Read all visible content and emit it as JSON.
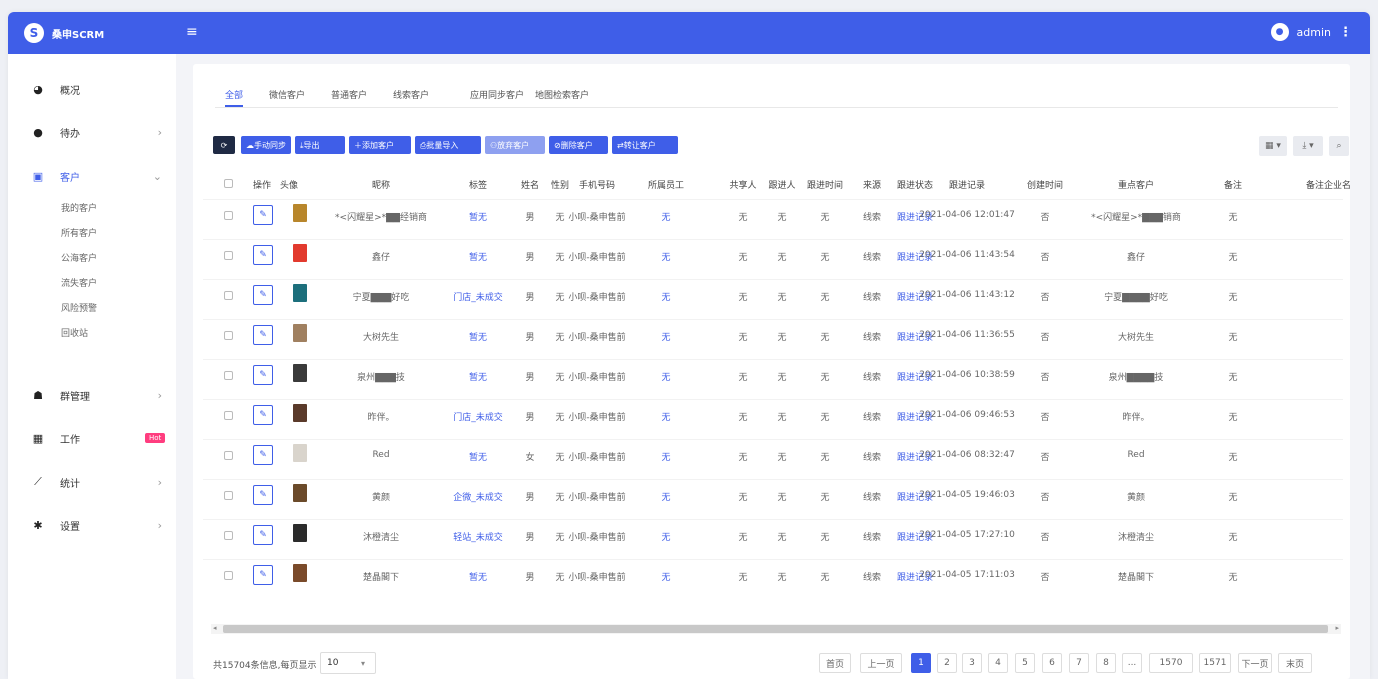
{
  "brand": {
    "logo_letter": "S",
    "name": "桑申SCRM"
  },
  "topbar": {
    "menu_icon": "≡",
    "avatar_letter": "●",
    "user": "admin",
    "more_icon": "⋮"
  },
  "sidebar": {
    "items": [
      {
        "label": "概况",
        "icon": "dashboard-icon",
        "glyph": "◕",
        "arrow": ""
      },
      {
        "label": "待办",
        "icon": "todo-icon",
        "glyph": "●",
        "arrow": "›"
      },
      {
        "label": "客户",
        "icon": "customer-card-icon",
        "glyph": "▣",
        "arrow": "⌄"
      },
      {
        "label": "群管理",
        "icon": "group-icon",
        "glyph": "☗",
        "arrow": "›"
      },
      {
        "label": "工作",
        "icon": "grid-icon",
        "glyph": "▦",
        "arrow": ""
      },
      {
        "label": "统计",
        "icon": "chart-line-icon",
        "glyph": "⟋",
        "arrow": "›"
      },
      {
        "label": "设置",
        "icon": "gear-icon",
        "glyph": "✱",
        "arrow": "›"
      }
    ],
    "hot_badge": "Hot",
    "customer_sub": [
      "我的客户",
      "所有客户",
      "公海客户",
      "流失客户",
      "风险预警",
      "回收站"
    ]
  },
  "tabs": [
    "全部",
    "微信客户",
    "普通客户",
    "线索客户",
    "应用同步客户",
    "地图检索客户"
  ],
  "toolbar": {
    "refresh": "⟳",
    "buttons": [
      "☁手动同步",
      "⤓导出",
      "＋添加客户",
      "⎙批量导入",
      "⚇放弃客户",
      "⊘删除客户",
      "⇄转让客户"
    ],
    "columns_menu": "▦ ▾",
    "export_menu": "⤓ ▾",
    "search_icon": "⌕"
  },
  "table": {
    "headers": [
      "操作",
      "头像",
      "昵称",
      "标签",
      "姓名",
      "性别",
      "手机号码",
      "所属员工",
      "共享人",
      "跟进人",
      "跟进时间",
      "来源",
      "跟进状态",
      "跟进记录",
      "创建时间",
      "重点客户",
      "备注",
      "备注企业名称"
    ],
    "rows": [
      {
        "nick": "*<闪耀星>*▇▇经销商",
        "tag": "暂无",
        "gender": "男",
        "phone": "无",
        "staff": "小呗-桑申售前",
        "share": "无",
        "follower": "无",
        "ftime": "无",
        "source": "无",
        "status": "线索",
        "record": "跟进记录",
        "created": "2021-04-06 12:01:47",
        "key": "否",
        "note": "*<闪耀星>*▇▇▇销商",
        "corp": "无",
        "thumb": "#b8862b"
      },
      {
        "nick": "鑫仔",
        "tag": "暂无",
        "gender": "男",
        "phone": "无",
        "staff": "小呗-桑申售前",
        "share": "无",
        "follower": "无",
        "ftime": "无",
        "source": "无",
        "status": "线索",
        "record": "跟进记录",
        "created": "2021-04-06 11:43:54",
        "key": "否",
        "note": "鑫仔",
        "corp": "无",
        "thumb": "#e23a2e"
      },
      {
        "nick": "宁夏▇▇▇好吃",
        "tag": "门店_未成交",
        "gender": "男",
        "phone": "无",
        "staff": "小呗-桑申售前",
        "share": "无",
        "follower": "无",
        "ftime": "无",
        "source": "无",
        "status": "线索",
        "record": "跟进记录",
        "created": "2021-04-06 11:43:12",
        "key": "否",
        "note": "宁夏▇▇▇▇好吃",
        "corp": "无",
        "thumb": "#1d6f7c"
      },
      {
        "nick": "大树先生",
        "tag": "暂无",
        "gender": "男",
        "phone": "无",
        "staff": "小呗-桑申售前",
        "share": "无",
        "follower": "无",
        "ftime": "无",
        "source": "无",
        "status": "线索",
        "record": "跟进记录",
        "created": "2021-04-06 11:36:55",
        "key": "否",
        "note": "大树先生",
        "corp": "无",
        "thumb": "#a08060"
      },
      {
        "nick": "泉州▇▇▇技",
        "tag": "暂无",
        "gender": "男",
        "phone": "无",
        "staff": "小呗-桑申售前",
        "share": "无",
        "follower": "无",
        "ftime": "无",
        "source": "无",
        "status": "线索",
        "record": "跟进记录",
        "created": "2021-04-06 10:38:59",
        "key": "否",
        "note": "泉州▇▇▇▇技",
        "corp": "无",
        "thumb": "#3a3a3a"
      },
      {
        "nick": "昨伴。",
        "tag": "门店_未成交",
        "gender": "男",
        "phone": "无",
        "staff": "小呗-桑申售前",
        "share": "无",
        "follower": "无",
        "ftime": "无",
        "source": "无",
        "status": "线索",
        "record": "跟进记录",
        "created": "2021-04-06 09:46:53",
        "key": "否",
        "note": "昨伴。",
        "corp": "无",
        "thumb": "#5a3a2a"
      },
      {
        "nick": "Red",
        "tag": "暂无",
        "gender": "女",
        "phone": "无",
        "staff": "小呗-桑申售前",
        "share": "无",
        "follower": "无",
        "ftime": "无",
        "source": "无",
        "status": "线索",
        "record": "跟进记录",
        "created": "2021-04-06 08:32:47",
        "key": "否",
        "note": "Red",
        "corp": "无",
        "thumb": "#d9d4cc"
      },
      {
        "nick": "黄颜",
        "tag": "企微_未成交",
        "gender": "男",
        "phone": "无",
        "staff": "小呗-桑申售前",
        "share": "无",
        "follower": "无",
        "ftime": "无",
        "source": "无",
        "status": "线索",
        "record": "跟进记录",
        "created": "2021-04-05 19:46:03",
        "key": "否",
        "note": "黄颜",
        "corp": "无",
        "thumb": "#6b4a2a"
      },
      {
        "nick": "沐橙清尘",
        "tag": "轻站_未成交",
        "gender": "男",
        "phone": "无",
        "staff": "小呗-桑申售前",
        "share": "无",
        "follower": "无",
        "ftime": "无",
        "source": "无",
        "status": "线索",
        "record": "跟进记录",
        "created": "2021-04-05 17:27:10",
        "key": "否",
        "note": "沐橙清尘",
        "corp": "无",
        "thumb": "#2b2b2b"
      },
      {
        "nick": "楚晶閣下",
        "tag": "暂无",
        "gender": "男",
        "phone": "无",
        "staff": "小呗-桑申售前",
        "share": "无",
        "follower": "无",
        "ftime": "无",
        "source": "无",
        "status": "线索",
        "record": "跟进记录",
        "created": "2021-04-05 17:11:03",
        "key": "否",
        "note": "楚晶閣下",
        "corp": "无",
        "thumb": "#7a4a2a"
      }
    ]
  },
  "scroll": {
    "left": "◂",
    "right": "▸"
  },
  "pagination": {
    "info": "共15704条信息,每页显示",
    "page_size": "10",
    "caret": "▾",
    "buttons": [
      "首页",
      "上一页",
      "1",
      "2",
      "3",
      "4",
      "5",
      "6",
      "7",
      "8",
      "...",
      "1570",
      "1571",
      "下一页",
      "末页"
    ]
  }
}
